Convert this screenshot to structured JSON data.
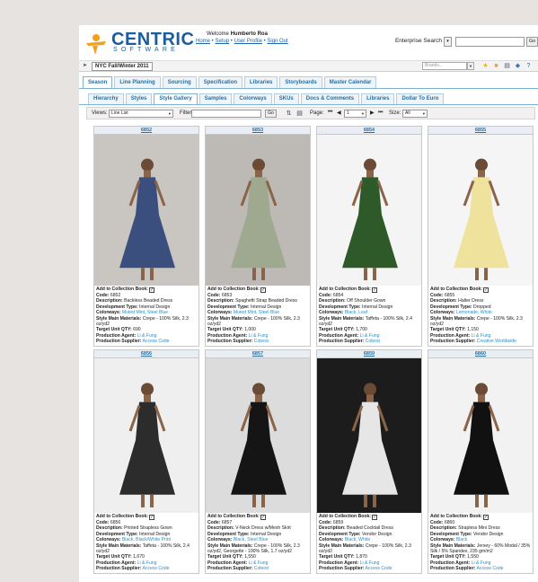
{
  "header": {
    "logo_text": "CENTRIC",
    "logo_sub": "SOFTWARE",
    "welcome_prefix": "Welcome",
    "user_name": "Humberto Roa",
    "links": [
      "Home",
      "Setup",
      "User Profile",
      "Sign Out"
    ],
    "enterprise_search_label": "Enterprise Search",
    "go_label": "Go"
  },
  "season_bar": {
    "season": "NYC Fall/Winter 2011",
    "brands_placeholder": "Brands..."
  },
  "tabs_primary": [
    {
      "label": "Season",
      "active": true
    },
    {
      "label": "Line Planning",
      "active": false
    },
    {
      "label": "Sourcing",
      "active": false
    },
    {
      "label": "Specification",
      "active": false
    },
    {
      "label": "Libraries",
      "active": false
    },
    {
      "label": "Storyboards",
      "active": false
    },
    {
      "label": "Master Calendar",
      "active": false
    }
  ],
  "tabs_secondary": [
    {
      "label": "Hierarchy",
      "active": false
    },
    {
      "label": "Styles",
      "active": false
    },
    {
      "label": "Style Gallery",
      "active": true
    },
    {
      "label": "Samples",
      "active": false
    },
    {
      "label": "Colorways",
      "active": false
    },
    {
      "label": "SKUs",
      "active": false
    },
    {
      "label": "Docs & Comments",
      "active": false
    },
    {
      "label": "Libraries",
      "active": false
    },
    {
      "label": "Dollar To Euro",
      "active": false
    }
  ],
  "toolbar": {
    "views_label": "Views:",
    "views_value": "Line List",
    "filter_label": "Filter:",
    "go_label": "Go",
    "page_label": "Page:",
    "page_value": "1",
    "size_label": "Size:",
    "size_value": "All"
  },
  "labels": {
    "add_to_book": "Add to Collection Book:",
    "code": "Code:",
    "description": "Description:",
    "dev_type": "Development Type:",
    "colorways": "Colorways:",
    "materials": "Style Main Materials:",
    "target_qty": "Target Unit QTY:",
    "agent": "Production Agent:",
    "supplier": "Production Supplier:"
  },
  "cards": [
    {
      "code": "6852",
      "description": "Backless Beaded Dress",
      "dev_type": "Internal Design",
      "colorways": "Muted Mint, Steel Blue",
      "materials": "Crepe - 100% Silk, 2.3 oz/yd2",
      "target_qty": "690",
      "agent": "Li & Fung",
      "supplier": "Access Code",
      "dress_color": "#3a4f7e",
      "bg": "#c9c6c2"
    },
    {
      "code": "6853",
      "description": "Spaghetti Strap Beaded Dress",
      "dev_type": "Internal Design",
      "colorways": "Muted Mint, Steel Blue",
      "materials": "Crepe - 100% Silk, 2.3 oz/yd2",
      "target_qty": "1,000",
      "agent": "Li & Fung",
      "supplier": "Cobest",
      "dress_color": "#9fa98f",
      "bg": "#bdbab6"
    },
    {
      "code": "6854",
      "description": "Off Shoulder Gown",
      "dev_type": "Internal Design",
      "colorways": "Black, Leaf",
      "materials": "Taffeta - 100% Silk, 2.4 oz/yd2",
      "target_qty": "1,700",
      "agent": "Li & Fung",
      "supplier": "Cobest",
      "dress_color": "#2e5a2a",
      "bg": "#f4f4f4"
    },
    {
      "code": "6855",
      "description": "Halter Dress",
      "dev_type": "Dropped",
      "colorways": "Lemonade, White",
      "materials": "Crepe - 100% Silk, 2.3 oz/yd2",
      "target_qty": "1,150",
      "agent": "Li & Fung",
      "supplier": "Creative Worldwide",
      "dress_color": "#efe29c",
      "bg": "#f5f5f5"
    },
    {
      "code": "6856",
      "description": "Printed Strapless Gown",
      "dev_type": "Internal Design",
      "colorways": "Black, Black/White Print",
      "materials": "Taffeta - 100% Silk, 2.4 oz/yd2",
      "target_qty": "1,670",
      "agent": "Li & Fung",
      "supplier": "Access Code",
      "dress_color": "#2c2c2c",
      "bg": "#efefef"
    },
    {
      "code": "6857",
      "description": "V-Neck Dress w/Mesh Skirt",
      "dev_type": "Internal Design",
      "colorways": "Black, Steel Blue",
      "materials": "Crepe - 100% Silk, 2.3 oz/yd2, Georgette - 100% Silk, 1.7 oz/yd2",
      "target_qty": "1,550",
      "agent": "Li & Fung",
      "supplier": "Cobest",
      "dress_color": "#151515",
      "bg": "#dcdcdc"
    },
    {
      "code": "6859",
      "description": "Beaded Cocktail Dress",
      "dev_type": "Vendor Design",
      "colorways": "Black, White",
      "materials": "Crepe - 100% Silk, 2.3 oz/yd2",
      "target_qty": "1,870",
      "agent": "Li & Fung",
      "supplier": "Access Code",
      "dress_color": "#e6e6e6",
      "bg": "#1c1c1c"
    },
    {
      "code": "6860",
      "description": "Strapless Mini Dress",
      "dev_type": "Vendor Design",
      "colorways": "Black",
      "materials": "Jersey - 60% Modal / 35% Silk / 5% Spandex, 235 gm/m2",
      "target_qty": "1,550",
      "agent": "Li & Fung",
      "supplier": "Access Code",
      "dress_color": "#111111",
      "bg": "#f2f2f2"
    }
  ],
  "colors": {
    "accent": "#2a6ea0",
    "link": "#2a8fc8",
    "brand": "#1b5d9e",
    "logo_orange": "#f5a01a"
  }
}
